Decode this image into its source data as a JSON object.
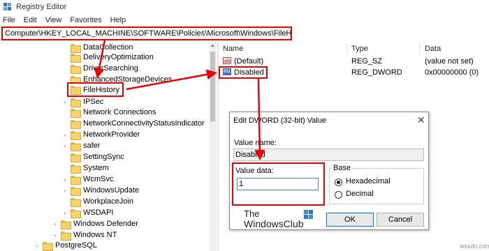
{
  "window": {
    "title": "Registry Editor",
    "app_icon": "registry-icon"
  },
  "menu": [
    "File",
    "Edit",
    "View",
    "Favorites",
    "Help"
  ],
  "address": "Computer\\HKEY_LOCAL_MACHINE\\SOFTWARE\\Policies\\Microsoft\\Windows\\FileHistory",
  "tree": [
    "DataCollection",
    "DeliveryOptimization",
    "DriverSearching",
    "EnhancedStorageDevices",
    "FileHistory",
    "IPSec",
    "Network Connections",
    "NetworkConnectivityStatusIndicator",
    "NetworkProvider",
    "safer",
    "SettingSync",
    "System",
    "WcmSvc",
    "WindowsUpdate",
    "WorkplaceJoin",
    "WSDAPI",
    "Windows Defender",
    "Windows NT",
    "PostgreSQL"
  ],
  "selected_key": "FileHistory",
  "columns": {
    "name": "Name",
    "type": "Type",
    "data": "Data"
  },
  "values": [
    {
      "name": "(Default)",
      "type": "REG_SZ",
      "data": "(value not set)",
      "icon": "string-value-icon"
    },
    {
      "name": "Disabled",
      "type": "REG_DWORD",
      "data": "0x00000000 (0)",
      "icon": "dword-value-icon"
    }
  ],
  "dialog": {
    "title": "Edit DWORD (32-bit) Value",
    "value_name_label": "Value name:",
    "value_name": "Disabled",
    "value_data_label": "Value data:",
    "value_data": "1",
    "base_label": "Base",
    "hex_label": "Hexadecimal",
    "dec_label": "Decimal",
    "base_selected": "Hexadecimal",
    "ok": "OK",
    "cancel": "Cancel"
  },
  "branding": {
    "the": "The",
    "name": "WindowsClub"
  },
  "watermark": "wsxdn.com",
  "colors": {
    "annotation": "#e00000",
    "folder": "#f8d36a",
    "accent": "#0078d7"
  }
}
